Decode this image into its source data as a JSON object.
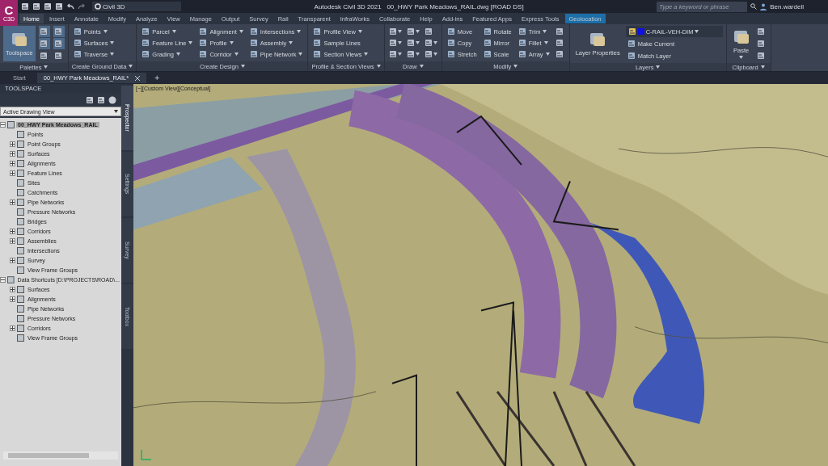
{
  "app_button": {
    "letter": "C",
    "caption": "C3D"
  },
  "workspace": {
    "value": "Civil 3D"
  },
  "window": {
    "title": "Autodesk Civil 3D 2021",
    "document": "00_HWY Park Meadows_RAIL.dwg [ROAD DS]"
  },
  "search": {
    "placeholder": "Type a keyword or phrase"
  },
  "user": {
    "name": "Ben.wardell"
  },
  "ribbon_tabs": [
    {
      "label": "Home",
      "selected": true,
      "contextual": false
    },
    {
      "label": "Insert",
      "selected": false,
      "contextual": false
    },
    {
      "label": "Annotate",
      "selected": false,
      "contextual": false
    },
    {
      "label": "Modify",
      "selected": false,
      "contextual": false
    },
    {
      "label": "Analyze",
      "selected": false,
      "contextual": false
    },
    {
      "label": "View",
      "selected": false,
      "contextual": false
    },
    {
      "label": "Manage",
      "selected": false,
      "contextual": false
    },
    {
      "label": "Output",
      "selected": false,
      "contextual": false
    },
    {
      "label": "Survey",
      "selected": false,
      "contextual": false
    },
    {
      "label": "Rail",
      "selected": false,
      "contextual": false
    },
    {
      "label": "Transparent",
      "selected": false,
      "contextual": false
    },
    {
      "label": "InfraWorks",
      "selected": false,
      "contextual": false
    },
    {
      "label": "Collaborate",
      "selected": false,
      "contextual": false
    },
    {
      "label": "Help",
      "selected": false,
      "contextual": false
    },
    {
      "label": "Add-ins",
      "selected": false,
      "contextual": false
    },
    {
      "label": "Featured Apps",
      "selected": false,
      "contextual": false
    },
    {
      "label": "Express Tools",
      "selected": false,
      "contextual": false
    },
    {
      "label": "Geolocation",
      "selected": false,
      "contextual": true
    }
  ],
  "ribbon_panels": [
    {
      "title": "Palettes",
      "columns": [
        [
          {
            "kind": "large",
            "label": "Toolspace",
            "active": true
          }
        ],
        [
          {
            "kind": "icon",
            "active": true
          },
          {
            "kind": "icon",
            "active": true
          },
          {
            "kind": "icon",
            "active": false
          }
        ],
        [
          {
            "kind": "icon",
            "active": true
          },
          {
            "kind": "icon",
            "active": true
          },
          {
            "kind": "icon",
            "active": false
          }
        ]
      ]
    },
    {
      "title": "Create Ground Data",
      "columns": [
        [
          {
            "kind": "small",
            "label": "Points",
            "dropdown": true
          },
          {
            "kind": "small",
            "label": "Surfaces",
            "dropdown": true
          },
          {
            "kind": "small",
            "label": "Traverse",
            "dropdown": true
          }
        ]
      ]
    },
    {
      "title": "Create Design",
      "columns": [
        [
          {
            "kind": "small",
            "label": "Parcel",
            "dropdown": true
          },
          {
            "kind": "small",
            "label": "Feature Line",
            "dropdown": true
          },
          {
            "kind": "small",
            "label": "Grading",
            "dropdown": true
          }
        ],
        [
          {
            "kind": "small",
            "label": "Alignment",
            "dropdown": true
          },
          {
            "kind": "small",
            "label": "Profile",
            "dropdown": true
          },
          {
            "kind": "small",
            "label": "Corridor",
            "dropdown": true
          }
        ],
        [
          {
            "kind": "small",
            "label": "Intersections",
            "dropdown": true
          },
          {
            "kind": "small",
            "label": "Assembly",
            "dropdown": true
          },
          {
            "kind": "small",
            "label": "Pipe Network",
            "dropdown": true
          }
        ]
      ]
    },
    {
      "title": "Profile & Section Views",
      "columns": [
        [
          {
            "kind": "small",
            "label": "Profile View",
            "dropdown": true
          },
          {
            "kind": "small",
            "label": "Sample Lines",
            "dropdown": false
          },
          {
            "kind": "small",
            "label": "Section Views",
            "dropdown": true
          }
        ]
      ]
    },
    {
      "title": "Draw",
      "columns": [
        [
          {
            "kind": "icon",
            "dropdown": true
          },
          {
            "kind": "icon",
            "dropdown": true
          },
          {
            "kind": "icon",
            "dropdown": true
          }
        ],
        [
          {
            "kind": "icon",
            "dropdown": true
          },
          {
            "kind": "icon",
            "dropdown": true
          },
          {
            "kind": "icon",
            "dropdown": true
          }
        ],
        [
          {
            "kind": "icon",
            "dropdown": false
          },
          {
            "kind": "icon",
            "dropdown": true
          },
          {
            "kind": "icon",
            "dropdown": true
          }
        ]
      ]
    },
    {
      "title": "Modify",
      "columns": [
        [
          {
            "kind": "small",
            "label": "Move",
            "dropdown": false
          },
          {
            "kind": "small",
            "label": "Copy",
            "dropdown": false
          },
          {
            "kind": "small",
            "label": "Stretch",
            "dropdown": false
          }
        ],
        [
          {
            "kind": "small",
            "label": "Rotate",
            "dropdown": false
          },
          {
            "kind": "small",
            "label": "Mirror",
            "dropdown": false
          },
          {
            "kind": "small",
            "label": "Scale",
            "dropdown": false
          }
        ],
        [
          {
            "kind": "small",
            "label": "Trim",
            "dropdown": true
          },
          {
            "kind": "small",
            "label": "Fillet",
            "dropdown": true
          },
          {
            "kind": "small",
            "label": "Array",
            "dropdown": true
          }
        ],
        [
          {
            "kind": "icon",
            "dropdown": false
          },
          {
            "kind": "icon",
            "dropdown": false
          },
          {
            "kind": "icon",
            "dropdown": false
          }
        ]
      ]
    },
    {
      "title": "Layers",
      "columns": [
        [
          {
            "kind": "large",
            "label": "Layer Properties",
            "active": false
          }
        ],
        [
          {
            "kind": "combo",
            "value": "C-RAIL-VEH-DIM",
            "color": "#1010e0"
          },
          {
            "kind": "small",
            "label": "Make Current",
            "dropdown": false
          },
          {
            "kind": "small",
            "label": "Match Layer",
            "dropdown": false
          }
        ]
      ]
    },
    {
      "title": "Clipboard",
      "columns": [
        [
          {
            "kind": "large",
            "label": "Paste",
            "active": false,
            "dropdown": true
          }
        ],
        [
          {
            "kind": "icon",
            "dropdown": false
          },
          {
            "kind": "icon",
            "dropdown": false
          },
          {
            "kind": "icon",
            "dropdown": false
          }
        ]
      ]
    }
  ],
  "file_tabs": [
    {
      "label": "Start",
      "selected": false,
      "closable": false
    },
    {
      "label": "00_HWY Park Meadows_RAIL*",
      "selected": true,
      "closable": true
    }
  ],
  "new_tab": {
    "symbol": "+"
  },
  "toolspace": {
    "title": "TOOLSPACE",
    "view": "Active Drawing View",
    "tree": [
      {
        "label": "00_HWY Park Meadows_RAIL",
        "selected": true,
        "expanded": true,
        "children": [
          {
            "label": "Points",
            "expandable": false
          },
          {
            "label": "Point Groups",
            "expandable": true
          },
          {
            "label": "Surfaces",
            "expandable": true
          },
          {
            "label": "Alignments",
            "expandable": true
          },
          {
            "label": "Feature Lines",
            "expandable": true
          },
          {
            "label": "Sites",
            "expandable": false
          },
          {
            "label": "Catchments",
            "expandable": false
          },
          {
            "label": "Pipe Networks",
            "expandable": true
          },
          {
            "label": "Pressure Networks",
            "expandable": false
          },
          {
            "label": "Bridges",
            "expandable": false
          },
          {
            "label": "Corridors",
            "expandable": true
          },
          {
            "label": "Assemblies",
            "expandable": true
          },
          {
            "label": "Intersections",
            "expandable": false
          },
          {
            "label": "Survey",
            "expandable": true
          },
          {
            "label": "View Frame Groups",
            "expandable": false
          }
        ]
      },
      {
        "label": "Data Shortcuts [D:\\PROJECTS\\ROAD\\...",
        "selected": false,
        "expanded": true,
        "children": [
          {
            "label": "Surfaces",
            "expandable": true
          },
          {
            "label": "Alignments",
            "expandable": true
          },
          {
            "label": "Pipe Networks",
            "expandable": false
          },
          {
            "label": "Pressure Networks",
            "expandable": false
          },
          {
            "label": "Corridors",
            "expandable": true
          },
          {
            "label": "View Frame Groups",
            "expandable": false
          }
        ]
      }
    ],
    "side_tabs": [
      {
        "label": "Prospector",
        "selected": true
      },
      {
        "label": "Settings",
        "selected": false
      },
      {
        "label": "Survey",
        "selected": false
      },
      {
        "label": "Toolbox",
        "selected": false
      }
    ]
  },
  "viewport": {
    "label": "[−][Custom View][Conceptual]"
  }
}
